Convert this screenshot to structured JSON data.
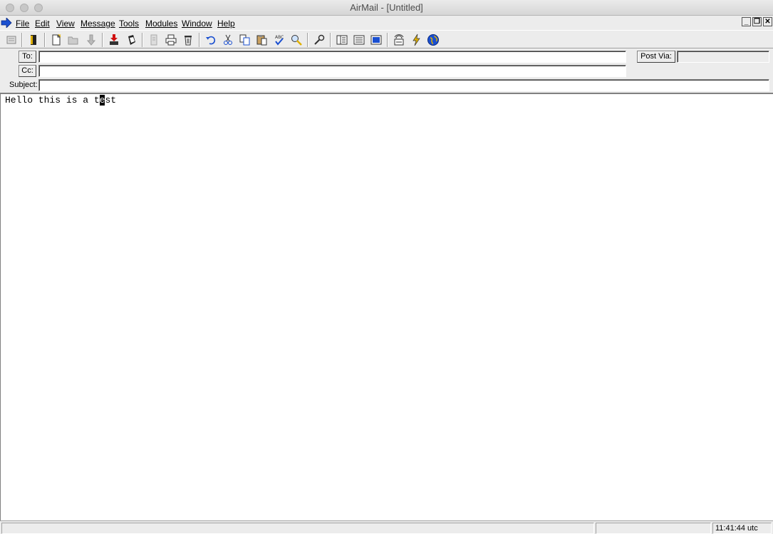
{
  "window": {
    "title": "AirMail - [Untitled]"
  },
  "menubar": {
    "items": [
      {
        "id": "file",
        "label": "File"
      },
      {
        "id": "edit",
        "label": "Edit"
      },
      {
        "id": "view",
        "label": "View"
      },
      {
        "id": "message",
        "label": "Message"
      },
      {
        "id": "tools",
        "label": "Tools"
      },
      {
        "id": "modules",
        "label": "Modules"
      },
      {
        "id": "window",
        "label": "Window"
      },
      {
        "id": "help",
        "label": "Help"
      }
    ]
  },
  "toolbar": {
    "buttons": [
      "address-book-icon",
      "book-icon",
      "new-message-icon",
      "open-folder-icon",
      "down-arrow-icon",
      "outbox-icon",
      "attach-icon",
      "document-icon",
      "print-icon",
      "trash-icon",
      "undo-icon",
      "cut-icon",
      "copy-icon",
      "paste-icon",
      "spellcheck-icon",
      "find-icon",
      "settings-wrench-icon",
      "view-split-icon",
      "view-list-icon",
      "view-preview-icon",
      "radio-tower-icon",
      "lightning-icon",
      "globe-icon"
    ]
  },
  "header": {
    "to_label": "To:",
    "cc_label": "Cc:",
    "subject_label": "Subject:",
    "post_via_label": "Post Via:",
    "to_value": "",
    "cc_value": "",
    "subject_value": "",
    "post_via_value": ""
  },
  "body": {
    "text_before": "Hello this is a t",
    "cursor_char": "e",
    "text_after": "st"
  },
  "status": {
    "pane1": "",
    "pane2": "",
    "clock": "11:41:44 utc"
  },
  "colors": {
    "accent_blue": "#1a4fd0",
    "icon_red": "#d01010",
    "icon_yellow": "#e0b000"
  }
}
